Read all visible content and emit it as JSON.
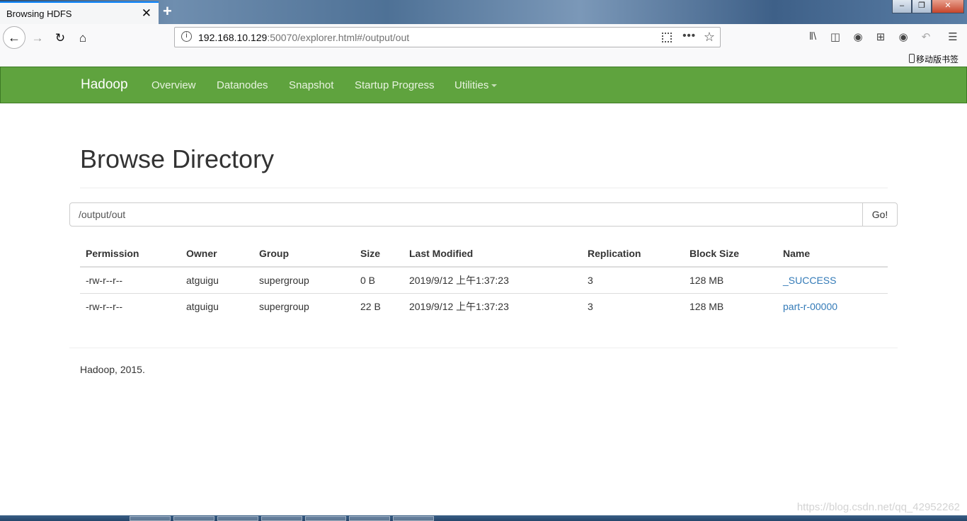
{
  "browser": {
    "tab_title": "Browsing HDFS",
    "tab_close": "✕",
    "new_tab": "+",
    "url_host": "192.168.10.129",
    "url_rest": ":50070/explorer.html#/output/out",
    "mobile_bookmarks": "移动版书签",
    "window_controls": {
      "minimize": "–",
      "maximize": "❐",
      "close": "✕"
    }
  },
  "hadoop_nav": {
    "brand": "Hadoop",
    "links": [
      "Overview",
      "Datanodes",
      "Snapshot",
      "Startup Progress",
      "Utilities"
    ]
  },
  "page": {
    "title": "Browse Directory",
    "path_value": "/output/out",
    "go_label": "Go!"
  },
  "table": {
    "headers": [
      "Permission",
      "Owner",
      "Group",
      "Size",
      "Last Modified",
      "Replication",
      "Block Size",
      "Name"
    ],
    "rows": [
      [
        "-rw-r--r--",
        "atguigu",
        "supergroup",
        "0 B",
        "2019/9/12 上午1:37:23",
        "3",
        "128 MB",
        "_SUCCESS"
      ],
      [
        "-rw-r--r--",
        "atguigu",
        "supergroup",
        "22 B",
        "2019/9/12 上午1:37:23",
        "3",
        "128 MB",
        "part-r-00000"
      ]
    ]
  },
  "footer": {
    "text": "Hadoop, 2015."
  },
  "watermark": "https://blog.csdn.net/qq_42952262",
  "colors": {
    "nav_green": "#5fa33e",
    "link_blue": "#337ab7",
    "tab_accent": "#0a84ff"
  },
  "icons": [
    "back-arrow-icon",
    "forward-arrow-icon",
    "reload-icon",
    "home-icon",
    "info-icon",
    "qr-code-icon",
    "more-icon",
    "star-icon",
    "library-icon",
    "sidebar-icon",
    "account-icon",
    "screenshot-icon",
    "chat-icon",
    "undo-icon",
    "menu-icon",
    "phone-icon"
  ]
}
